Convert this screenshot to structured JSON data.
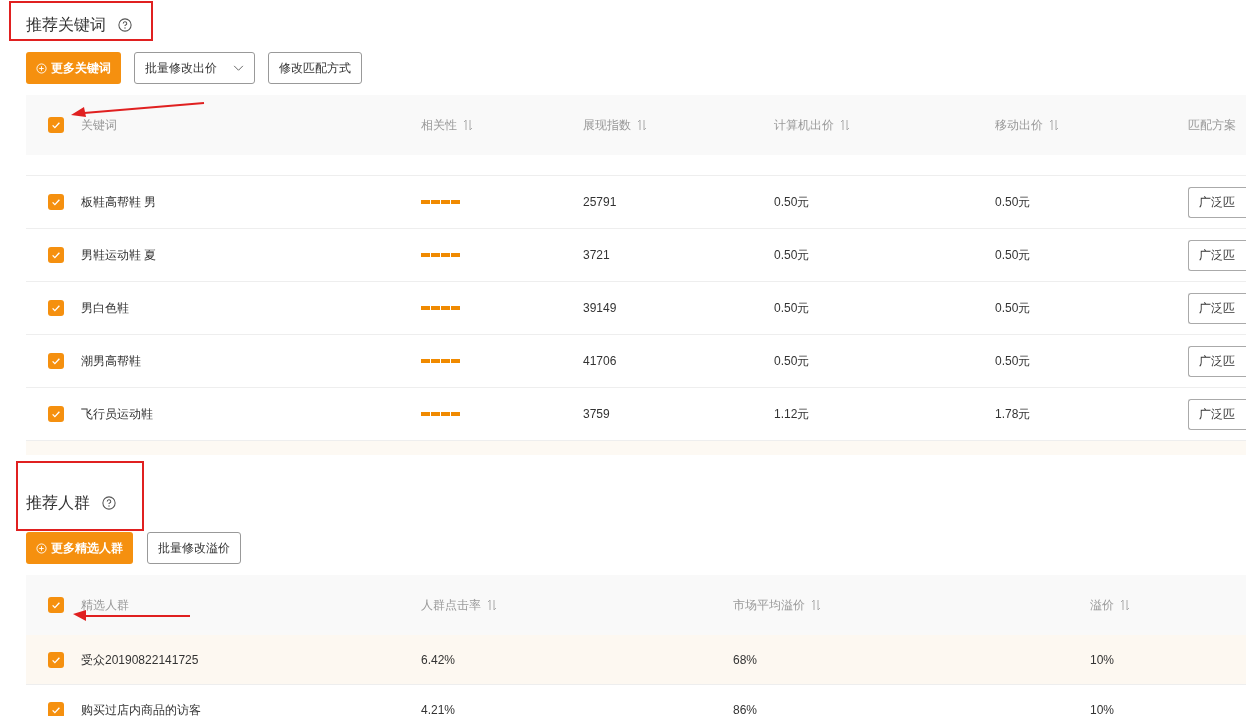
{
  "keyword_section": {
    "title": "推荐关键词",
    "buttons": [
      {
        "label": "更多关键词",
        "kind": "primary"
      },
      {
        "label": "批量修改出价",
        "kind": "dropdown"
      },
      {
        "label": "修改匹配方式",
        "kind": "plain"
      }
    ],
    "table": {
      "select_all": {
        "checked": true
      },
      "columns": [
        {
          "label": "关键词",
          "sortable": false
        },
        {
          "label": "相关性",
          "sortable": true
        },
        {
          "label": "展现指数",
          "sortable": true
        },
        {
          "label": "计算机出价",
          "sortable": true
        },
        {
          "label": "移动出价",
          "sortable": true
        },
        {
          "label": "匹配方案",
          "sortable": false
        }
      ],
      "rows": [
        {
          "checked": true,
          "keyword": "板鞋高帮鞋 男",
          "stars": 4,
          "impressions": "25791",
          "pc_bid": "0.50元",
          "mobile_bid": "0.50元",
          "match": "广泛匹"
        },
        {
          "checked": true,
          "keyword": "男鞋运动鞋 夏",
          "stars": 4,
          "impressions": "3721",
          "pc_bid": "0.50元",
          "mobile_bid": "0.50元",
          "match": "广泛匹"
        },
        {
          "checked": true,
          "keyword": "男白色鞋",
          "stars": 4,
          "impressions": "39149",
          "pc_bid": "0.50元",
          "mobile_bid": "0.50元",
          "match": "广泛匹"
        },
        {
          "checked": true,
          "keyword": "潮男高帮鞋",
          "stars": 4,
          "impressions": "41706",
          "pc_bid": "0.50元",
          "mobile_bid": "0.50元",
          "match": "广泛匹"
        },
        {
          "checked": true,
          "keyword": "飞行员运动鞋",
          "stars": 4,
          "impressions": "3759",
          "pc_bid": "1.12元",
          "mobile_bid": "1.78元",
          "match": "广泛匹"
        }
      ]
    }
  },
  "audience_section": {
    "title": "推荐人群",
    "buttons": [
      {
        "label": "更多精选人群",
        "kind": "primary"
      },
      {
        "label": "批量修改溢价",
        "kind": "plain"
      }
    ],
    "table": {
      "select_all": {
        "checked": true
      },
      "columns": [
        {
          "label": "精选人群",
          "sortable": false
        },
        {
          "label": "人群点击率",
          "sortable": true
        },
        {
          "label": "市场平均溢价",
          "sortable": true
        },
        {
          "label": "溢价",
          "sortable": true
        }
      ],
      "rows": [
        {
          "checked": true,
          "highlighted": true,
          "cells": [
            "受众20190822141725",
            "6.42%",
            "68%",
            "10%"
          ]
        },
        {
          "checked": true,
          "highlighted": false,
          "cells": [
            "购买过店内商品的访客",
            "4.21%",
            "86%",
            "10%"
          ]
        }
      ]
    }
  }
}
